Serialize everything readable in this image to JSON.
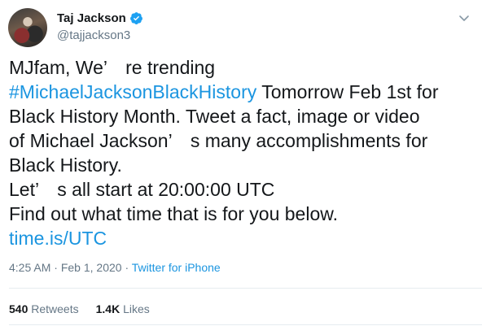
{
  "author": {
    "display_name": "Taj Jackson",
    "handle": "@tajjackson3",
    "verified": true
  },
  "tweet": {
    "text_lines": [
      [
        {
          "text": "MJfam, We’　re trending",
          "link": false
        }
      ],
      [
        {
          "text": "#MichaelJacksonBlackHistory",
          "link": true
        },
        {
          "text": " Tomorrow Feb 1st for",
          "link": false
        }
      ],
      [
        {
          "text": "Black History Month. Tweet a fact, image or video",
          "link": false
        }
      ],
      [
        {
          "text": "of Michael Jackson’　s many accomplishments for",
          "link": false
        }
      ],
      [
        {
          "text": "Black History.",
          "link": false
        }
      ],
      [
        {
          "text": "Let’　s all start at 20:00:00 UTC",
          "link": false
        }
      ],
      [
        {
          "text": "Find out what time that is for you below.",
          "link": false
        }
      ],
      [
        {
          "text": "time.is/UTC",
          "link": true
        }
      ]
    ]
  },
  "meta": {
    "time": "4:25 AM",
    "separator": " · ",
    "date": "Feb 1, 2020",
    "source": "Twitter for iPhone"
  },
  "stats": {
    "retweets_count": "540",
    "retweets_label": "Retweets",
    "likes_count": "1.4K",
    "likes_label": "Likes"
  },
  "colors": {
    "link": "#1b95e0",
    "secondary_text": "#657786",
    "verified_badge": "#1da1f2"
  },
  "icons": {
    "verified": "verified-badge-icon",
    "menu": "chevron-down-icon"
  }
}
